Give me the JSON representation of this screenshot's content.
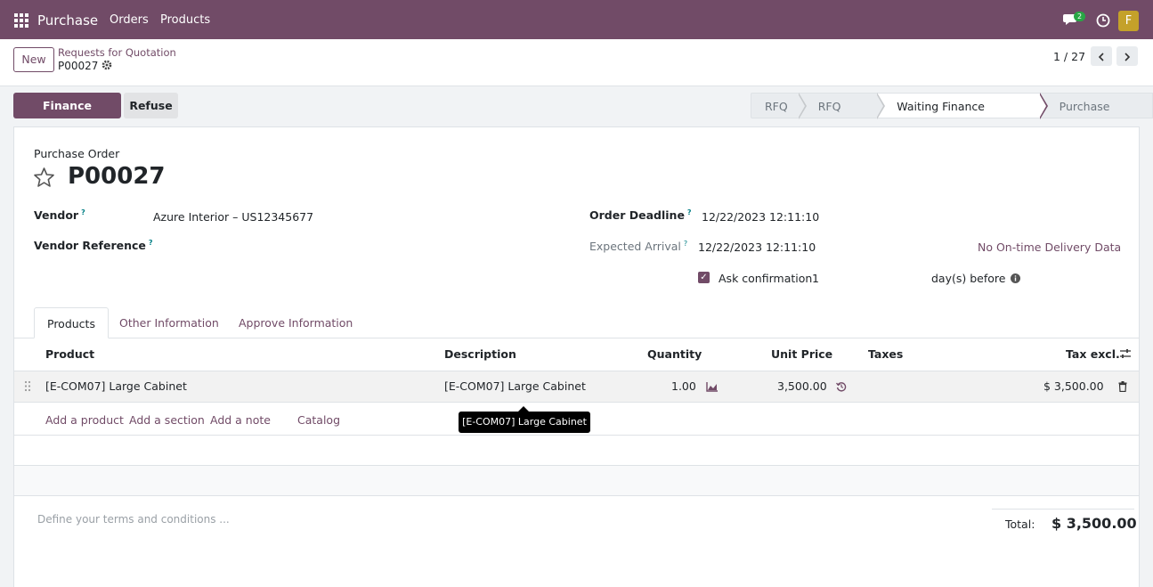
{
  "navbar": {
    "app_name": "Purchase",
    "menu": [
      "Orders",
      "Products"
    ],
    "chat_count": "2",
    "user_initial": "F",
    "color": "#714b67"
  },
  "control_panel": {
    "new_label": "New",
    "breadcrumb_parent": "Requests for Quotation",
    "breadcrumb_current": "P00027",
    "pager": "1 / 27"
  },
  "actions": {
    "approve_label": "Finance Approval",
    "refuse_label": "Refuse"
  },
  "statusbar": {
    "stages": [
      "RFQ",
      "RFQ Sent",
      "Waiting Finance Approval",
      "Purchase Order"
    ],
    "active": "Waiting Finance Approval"
  },
  "form": {
    "record_type": "Purchase Order",
    "record_name": "P00027",
    "vendor_label": "Vendor",
    "vendor_value": "Azure Interior – US12345677",
    "vendor_ref_label": "Vendor Reference",
    "order_deadline_label": "Order Deadline",
    "order_deadline_value": "12/22/2023 12:11:10",
    "expected_arrival_label": "Expected Arrival",
    "expected_arrival_value": "12/22/2023 12:11:10",
    "ontime_link": "No On-time Delivery Data",
    "ask_confirmation_label": "Ask confirmation",
    "ask_confirmation_days": "1",
    "days_before_label": "day(s) before",
    "help_mark": "?"
  },
  "tabs": [
    "Products",
    "Other Information",
    "Approve Information"
  ],
  "table": {
    "headers": {
      "product": "Product",
      "description": "Description",
      "quantity": "Quantity",
      "unit_price": "Unit Price",
      "taxes": "Taxes",
      "tax_excl": "Tax excl."
    },
    "rows": [
      {
        "product": "[E-COM07] Large Cabinet",
        "description": "[E-COM07] Large Cabinet",
        "quantity": "1.00",
        "unit_price": "3,500.00",
        "taxes": "",
        "subtotal": "$ 3,500.00"
      }
    ],
    "add_product": "Add a product",
    "add_section": "Add a section",
    "add_note": "Add a note",
    "catalog": "Catalog",
    "tooltip": "[E-COM07] Large Cabinet"
  },
  "footer": {
    "terms_placeholder": "Define your terms and conditions ...",
    "total_label": "Total:",
    "total_value": "$ 3,500.00"
  }
}
